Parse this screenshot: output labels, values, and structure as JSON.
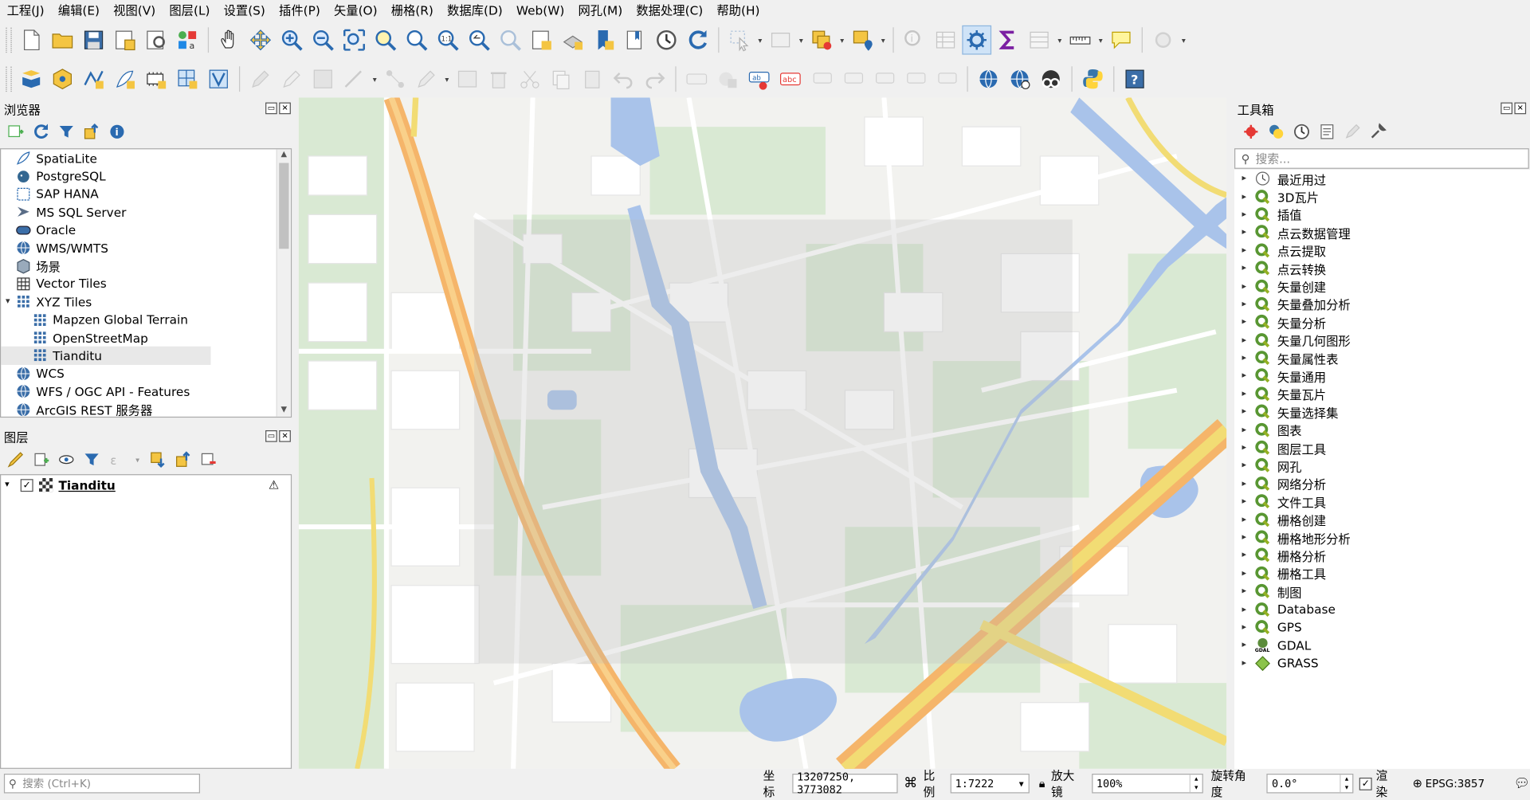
{
  "menu": [
    "工程(J)",
    "编辑(E)",
    "视图(V)",
    "图层(L)",
    "设置(S)",
    "插件(P)",
    "矢量(O)",
    "栅格(R)",
    "数据库(D)",
    "Web(W)",
    "网孔(M)",
    "数据处理(C)",
    "帮助(H)"
  ],
  "browser": {
    "title": "浏览器",
    "items": [
      {
        "label": "SpatiaLite",
        "icon": "feather-icon",
        "indent": 0,
        "expander": ""
      },
      {
        "label": "PostgreSQL",
        "icon": "elephant-icon",
        "indent": 0,
        "expander": ""
      },
      {
        "label": "SAP HANA",
        "icon": "hana-icon",
        "indent": 0,
        "expander": ""
      },
      {
        "label": "MS SQL Server",
        "icon": "mssql-icon",
        "indent": 0,
        "expander": ""
      },
      {
        "label": "Oracle",
        "icon": "oracle-icon",
        "indent": 0,
        "expander": ""
      },
      {
        "label": "WMS/WMTS",
        "icon": "globe-icon",
        "indent": 0,
        "expander": ""
      },
      {
        "label": "场景",
        "icon": "cube-icon",
        "indent": 0,
        "expander": ""
      },
      {
        "label": "Vector Tiles",
        "icon": "grid-icon",
        "indent": 0,
        "expander": ""
      },
      {
        "label": "XYZ Tiles",
        "icon": "grid-blue-icon",
        "indent": 0,
        "expander": "▾"
      },
      {
        "label": "Mapzen Global Terrain",
        "icon": "grid-blue-icon",
        "indent": 1,
        "expander": ""
      },
      {
        "label": "OpenStreetMap",
        "icon": "grid-blue-icon",
        "indent": 1,
        "expander": ""
      },
      {
        "label": "Tianditu",
        "icon": "grid-blue-icon",
        "indent": 1,
        "expander": "",
        "selected": true
      },
      {
        "label": "WCS",
        "icon": "globe-icon",
        "indent": 0,
        "expander": ""
      },
      {
        "label": "WFS / OGC API - Features",
        "icon": "globe-icon",
        "indent": 0,
        "expander": ""
      },
      {
        "label": "ArcGIS REST 服务器",
        "icon": "globe-icon",
        "indent": 0,
        "expander": ""
      }
    ]
  },
  "layers": {
    "title": "图层",
    "items": [
      {
        "label": "Tianditu",
        "checked": "✓"
      }
    ]
  },
  "toolbox": {
    "title": "工具箱",
    "search_placeholder": "搜索...",
    "items": [
      "最近用过",
      "3D瓦片",
      "插值",
      "点云数据管理",
      "点云提取",
      "点云转换",
      "矢量创建",
      "矢量叠加分析",
      "矢量分析",
      "矢量几何图形",
      "矢量属性表",
      "矢量通用",
      "矢量瓦片",
      "矢量选择集",
      "图表",
      "图层工具",
      "网孔",
      "网络分析",
      "文件工具",
      "栅格创建",
      "栅格地形分析",
      "栅格分析",
      "栅格工具",
      "制图",
      "Database",
      "GPS",
      "GDAL",
      "GRASS"
    ]
  },
  "status": {
    "search_placeholder": "搜索 (Ctrl+K)",
    "coord_label": "坐标",
    "coord_value": "13207250, 3773082",
    "scale_label": "比例",
    "scale_value": "1:7222",
    "magnifier_label": "放大镜",
    "magnifier_value": "100%",
    "rotation_label": "旋转角度",
    "rotation_value": "0.0°",
    "render_label": "渲染",
    "crs": "EPSG:3857"
  },
  "colors": {
    "water": "#a9c3ea",
    "road_major": "#f5b56a",
    "road_yellow": "#f2dc74",
    "green": "#d9e9d3",
    "base": "#f2f2ef"
  }
}
